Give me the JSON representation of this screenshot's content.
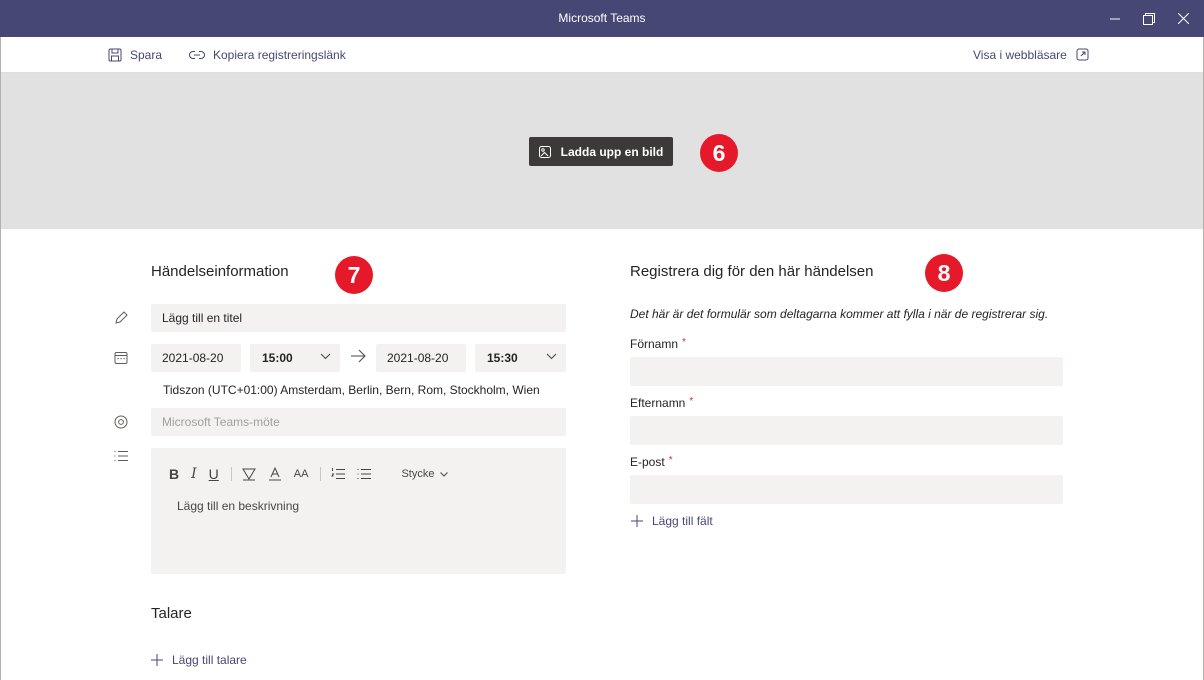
{
  "window": {
    "title": "Microsoft Teams"
  },
  "toolbar": {
    "save_label": "Spara",
    "copy_link_label": "Kopiera registreringslänk",
    "view_in_browser_label": "Visa i webbläsare"
  },
  "banner": {
    "upload_label": "Ladda upp en bild"
  },
  "markers": {
    "m6": "6",
    "m7": "7",
    "m8": "8"
  },
  "event_info": {
    "heading": "Händelseinformation",
    "title_placeholder": "Lägg till en titel",
    "start_date": "2021-08-20",
    "start_time": "15:00",
    "end_date": "2021-08-20",
    "end_time": "15:30",
    "timezone": "Tidszon (UTC+01:00) Amsterdam, Berlin, Bern, Rom, Stockholm, Wien",
    "location_placeholder": "Microsoft Teams-möte",
    "editor": {
      "bold": "B",
      "italic": "I",
      "underline": "U",
      "font_size": "AA",
      "paragraph_style": "Stycke",
      "placeholder": "Lägg till en beskrivning"
    }
  },
  "speakers": {
    "heading": "Talare",
    "add_label": "Lägg till talare"
  },
  "registration": {
    "heading": "Registrera dig för den här händelsen",
    "description": "Det här är det formulär som deltagarna kommer att fylla i när de registrerar sig.",
    "required_mark": "*",
    "fields": {
      "first_name": "Förnamn",
      "last_name": "Efternamn",
      "email": "E-post"
    },
    "add_field_label": "Lägg till fält"
  },
  "colors": {
    "titlebar": "#464775",
    "accent": "#464775",
    "marker": "#e5192a",
    "banner": "#e1e1e1",
    "field_bg": "#f3f2f1",
    "required": "#c4314b"
  }
}
